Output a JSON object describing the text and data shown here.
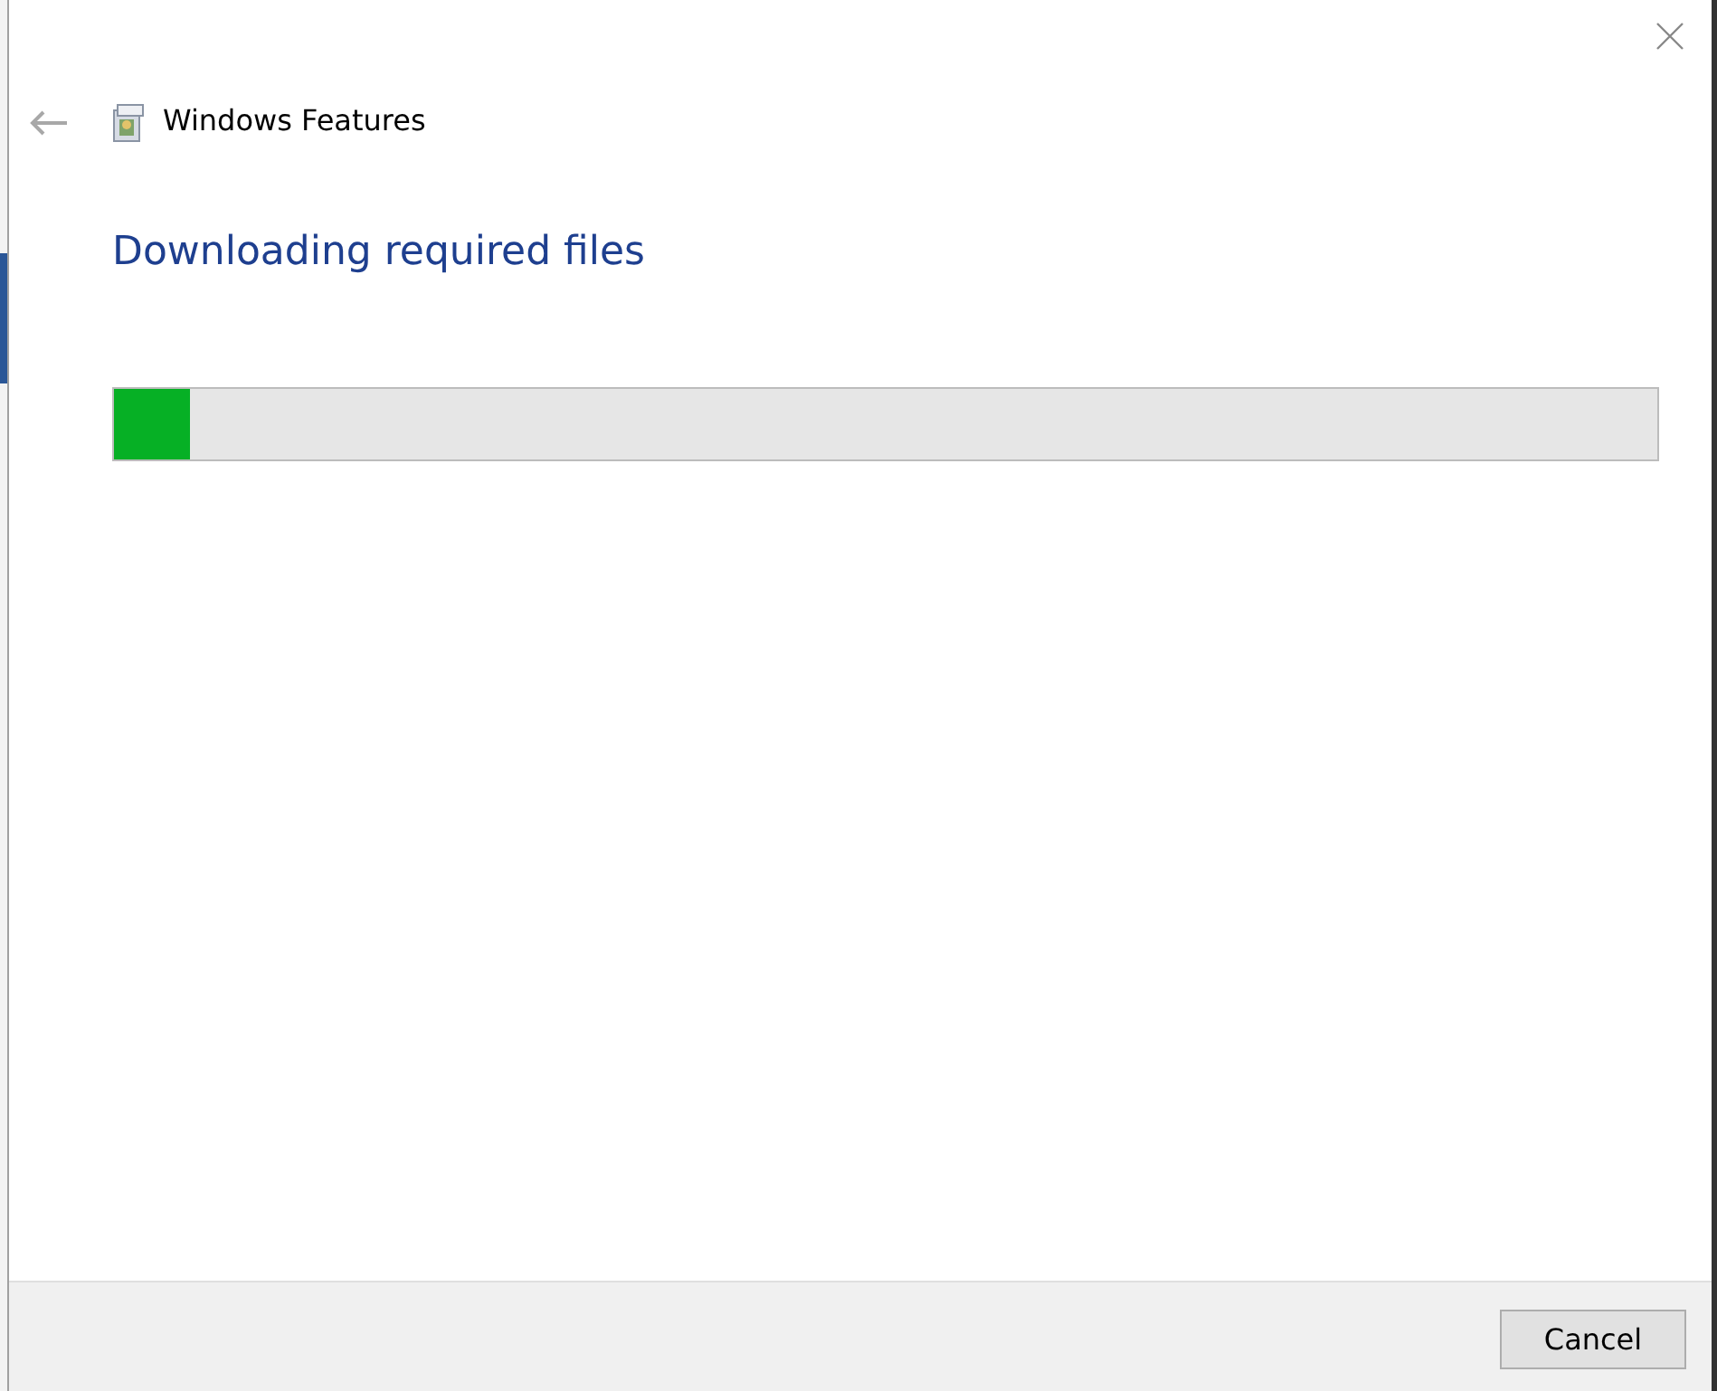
{
  "window": {
    "title": "Windows Features"
  },
  "heading": "Downloading required files",
  "progress": {
    "level": 0.049
  },
  "buttons": [
    {
      "label": "Cancel"
    }
  ]
}
